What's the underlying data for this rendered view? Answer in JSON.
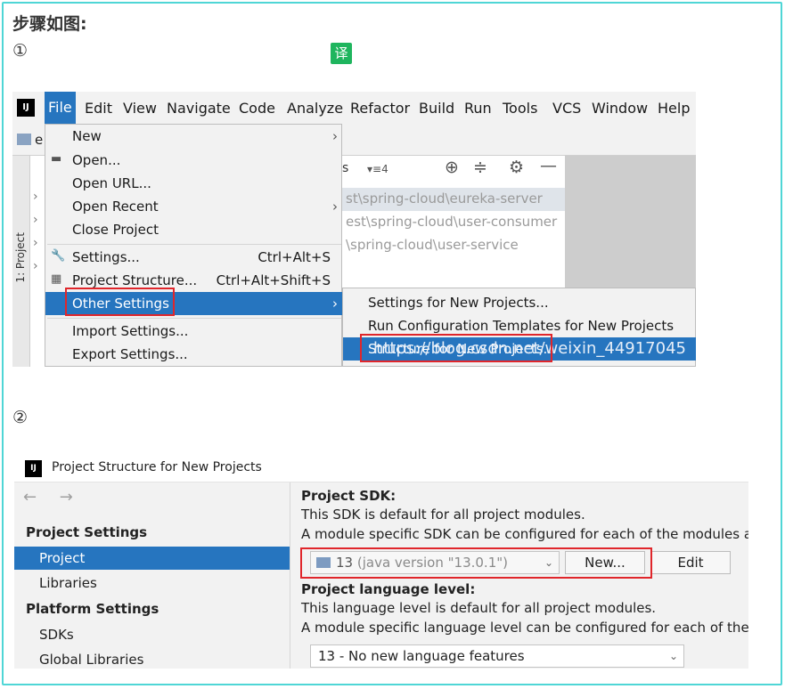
{
  "heading": "步骤如图:",
  "step1_marker": "①",
  "step2_marker": "②",
  "translate_badge": "译",
  "shot1": {
    "logo": "IJ",
    "menubar": [
      "File",
      "Edit",
      "View",
      "Navigate",
      "Code",
      "Analyze",
      "Refactor",
      "Build",
      "Run",
      "Tools",
      "VCS",
      "Window",
      "Help"
    ],
    "toolbar_label": "e",
    "side_label": "1: Project",
    "project_header_s": "s",
    "project_header_btn": "▾≡4",
    "project_paths": [
      "st\\spring-cloud\\eureka-server",
      "est\\spring-cloud\\user-consumer",
      "\\spring-cloud\\user-service"
    ],
    "file_menu": [
      {
        "label": "New",
        "arrow": "›"
      },
      {
        "label": "Open...",
        "icon": "folder-icon"
      },
      {
        "label": "Open URL..."
      },
      {
        "label": "Open Recent",
        "arrow": "›"
      },
      {
        "label": "Close Project"
      },
      {
        "label": "Settings...",
        "shortcut": "Ctrl+Alt+S",
        "icon": "wrench-icon"
      },
      {
        "label": "Project Structure...",
        "shortcut": "Ctrl+Alt+Shift+S",
        "icon": "project-structure-icon"
      },
      {
        "label": "Other Settings",
        "arrow": "›"
      },
      {
        "label": "Import Settings..."
      },
      {
        "label": "Export Settings..."
      }
    ],
    "submenu": [
      "Settings for New Projects...",
      "Run Configuration Templates for New Projects",
      "Structure for New Projects..."
    ],
    "watermark": "https://blog.csdn.net/weixin_44917045"
  },
  "shot2": {
    "logo": "IJ",
    "title": "Project Structure for New Projects",
    "nav_arrows": "← →",
    "sidebar": {
      "project_settings_header": "Project Settings",
      "items_ps": [
        "Project",
        "Libraries"
      ],
      "platform_settings_header": "Platform Settings",
      "items_pl": [
        "SDKs",
        "Global Libraries"
      ]
    },
    "content": {
      "sdk_header": "Project SDK:",
      "sdk_desc1": "This SDK is default for all project modules.",
      "sdk_desc2": "A module specific SDK can be configured for each of the modules as",
      "sdk_value": "13",
      "sdk_version": "(java version \"13.0.1\")",
      "new_button": "New...",
      "edit_button": "Edit",
      "lang_header": "Project language level:",
      "lang_desc1": "This language level is default for all project modules.",
      "lang_desc2": "A module specific language level can be configured for each of the m",
      "lang_value": "13 - No new language features"
    }
  },
  "colors": {
    "accent": "#2675bf",
    "highlight_box": "#e0262b",
    "frame": "#4fd6d6",
    "badge": "#1fb55e"
  }
}
